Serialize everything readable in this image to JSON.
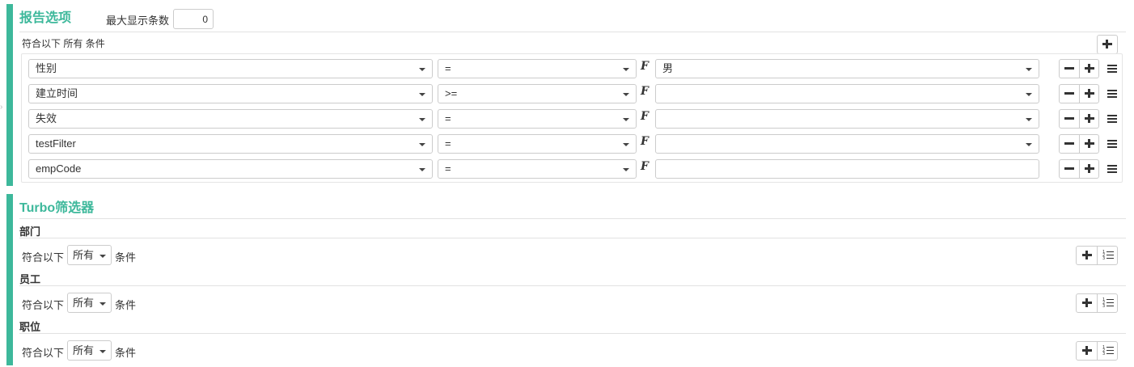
{
  "report_options": {
    "title": "报告选项",
    "max_rows_label": "最大显示条数",
    "max_rows_value": "0",
    "condition_prefix": "符合以下",
    "condition_mode": "所有",
    "condition_suffix": "条件",
    "filters": [
      {
        "field": "性别",
        "operator": "=",
        "value": "男",
        "value_type": "select"
      },
      {
        "field": "建立时间",
        "operator": ">=",
        "value": "",
        "value_type": "select"
      },
      {
        "field": "失效",
        "operator": "=",
        "value": "",
        "value_type": "select"
      },
      {
        "field": "testFilter",
        "operator": "=",
        "value": "",
        "value_type": "select"
      },
      {
        "field": "empCode",
        "operator": "=",
        "value": "",
        "value_type": "input"
      }
    ],
    "function_symbol": "𝓕"
  },
  "turbo": {
    "title": "Turbo筛选器",
    "groups": [
      {
        "name": "部门",
        "prefix": "符合以下",
        "mode": "所有",
        "suffix": "条件"
      },
      {
        "name": "员工",
        "prefix": "符合以下",
        "mode": "所有",
        "suffix": "条件"
      },
      {
        "name": "职位",
        "prefix": "符合以下",
        "mode": "所有",
        "suffix": "条件"
      }
    ]
  },
  "colors": {
    "accent": "#3db89b",
    "border": "#cccccc",
    "text": "#333333"
  },
  "icons": [
    "plus-icon",
    "minus-icon",
    "drag-handle-icon",
    "function-icon",
    "caret-down-icon",
    "list-ordered-icon"
  ]
}
